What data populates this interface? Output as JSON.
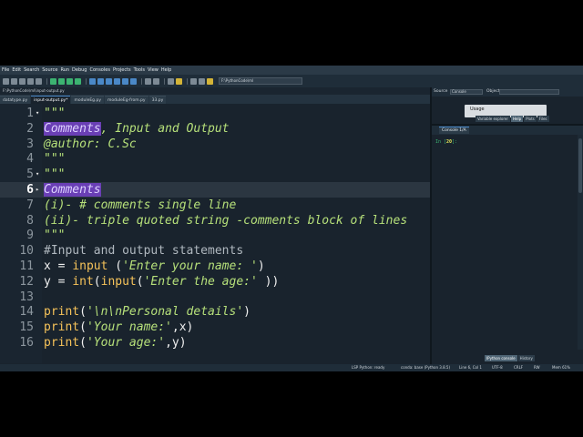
{
  "menu": [
    "File",
    "Edit",
    "Search",
    "Source",
    "Run",
    "Debug",
    "Consoles",
    "Projects",
    "Tools",
    "View",
    "Help"
  ],
  "toolbar": {
    "path_value": "F:\\PythonCode\\ml"
  },
  "editor": {
    "file_path": "F:\\PythonCode\\ml\\input-output.py",
    "tabs": [
      {
        "label": "datatype.py",
        "active": false
      },
      {
        "label": "input-output.py*",
        "active": true
      },
      {
        "label": "moduleEg.py",
        "active": false
      },
      {
        "label": "moduleEg-from.py",
        "active": false
      },
      {
        "label": "33.py",
        "active": false
      }
    ],
    "current_line": 6,
    "lines": [
      {
        "n": "1",
        "fold": "▾",
        "segs": [
          {
            "t": "\"\"\"",
            "c": "str"
          }
        ]
      },
      {
        "n": "2",
        "fold": "",
        "segs": [
          {
            "t": "Comments",
            "c": "str hl"
          },
          {
            "t": ", Input and Output",
            "c": "str"
          }
        ]
      },
      {
        "n": "3",
        "fold": "",
        "segs": [
          {
            "t": "@author: C.Sc",
            "c": "str"
          }
        ]
      },
      {
        "n": "4",
        "fold": "",
        "segs": [
          {
            "t": "\"\"\"",
            "c": "str"
          }
        ]
      },
      {
        "n": "5",
        "fold": "▾",
        "segs": [
          {
            "t": "\"\"\"",
            "c": "str"
          }
        ]
      },
      {
        "n": "6",
        "fold": "▸",
        "segs": [
          {
            "t": "Comments",
            "c": "str hl"
          }
        ]
      },
      {
        "n": "7",
        "fold": "",
        "segs": [
          {
            "t": "(i)- # comments single line",
            "c": "str"
          }
        ]
      },
      {
        "n": "8",
        "fold": "",
        "segs": [
          {
            "t": "(ii)- triple quoted string -comments block of lines",
            "c": "str"
          }
        ]
      },
      {
        "n": "9",
        "fold": "",
        "segs": [
          {
            "t": "\"\"\"",
            "c": "str"
          }
        ]
      },
      {
        "n": "10",
        "fold": "",
        "segs": [
          {
            "t": "#Input and output statements",
            "c": "cm"
          }
        ]
      },
      {
        "n": "11",
        "fold": "",
        "segs": [
          {
            "t": "x = ",
            "c": "plain"
          },
          {
            "t": "input",
            "c": "kw"
          },
          {
            "t": " (",
            "c": "plain"
          },
          {
            "t": "'Enter your name: '",
            "c": "str"
          },
          {
            "t": ")",
            "c": "plain"
          }
        ]
      },
      {
        "n": "12",
        "fold": "",
        "segs": [
          {
            "t": "y = ",
            "c": "plain"
          },
          {
            "t": "int",
            "c": "kw"
          },
          {
            "t": "(",
            "c": "plain"
          },
          {
            "t": "input",
            "c": "kw"
          },
          {
            "t": "(",
            "c": "plain"
          },
          {
            "t": "'Enter the age:'",
            "c": "str"
          },
          {
            "t": " ))",
            "c": "plain"
          }
        ]
      },
      {
        "n": "13",
        "fold": "",
        "segs": []
      },
      {
        "n": "14",
        "fold": "",
        "segs": [
          {
            "t": "print",
            "c": "kw"
          },
          {
            "t": "(",
            "c": "plain"
          },
          {
            "t": "'\\n\\nPersonal details'",
            "c": "str"
          },
          {
            "t": ")",
            "c": "plain"
          }
        ]
      },
      {
        "n": "15",
        "fold": "",
        "segs": [
          {
            "t": "print",
            "c": "kw"
          },
          {
            "t": "(",
            "c": "plain"
          },
          {
            "t": "'Your name:'",
            "c": "str"
          },
          {
            "t": ",x)",
            "c": "plain"
          }
        ]
      },
      {
        "n": "16",
        "fold": "",
        "segs": [
          {
            "t": "print",
            "c": "kw"
          },
          {
            "t": "(",
            "c": "plain"
          },
          {
            "t": "'Your age:'",
            "c": "str"
          },
          {
            "t": ",y)",
            "c": "plain"
          }
        ]
      }
    ]
  },
  "help_pane": {
    "source_label": "Source",
    "source_value": "Console",
    "object_label": "Object",
    "usage_title": "Usage",
    "tabs": [
      {
        "label": "Variable explorer",
        "active": false
      },
      {
        "label": "Help",
        "active": true
      },
      {
        "label": "Plots",
        "active": false
      },
      {
        "label": "Files",
        "active": false
      }
    ]
  },
  "console": {
    "tab_label": "Console 1/A",
    "prompt_prefix": "In [",
    "prompt_number": "20",
    "prompt_suffix": "]:",
    "bottom_tabs": [
      {
        "label": "IPython console",
        "active": true
      },
      {
        "label": "History",
        "active": false
      }
    ]
  },
  "status": {
    "lsp": "LSP Python: ready",
    "conda": "conda: base (Python 3.8.5)",
    "position": "Line 6, Col 1",
    "encoding": "UTF-8",
    "eol": "CRLF",
    "perm": "RW",
    "mem": "Mem 61%"
  }
}
